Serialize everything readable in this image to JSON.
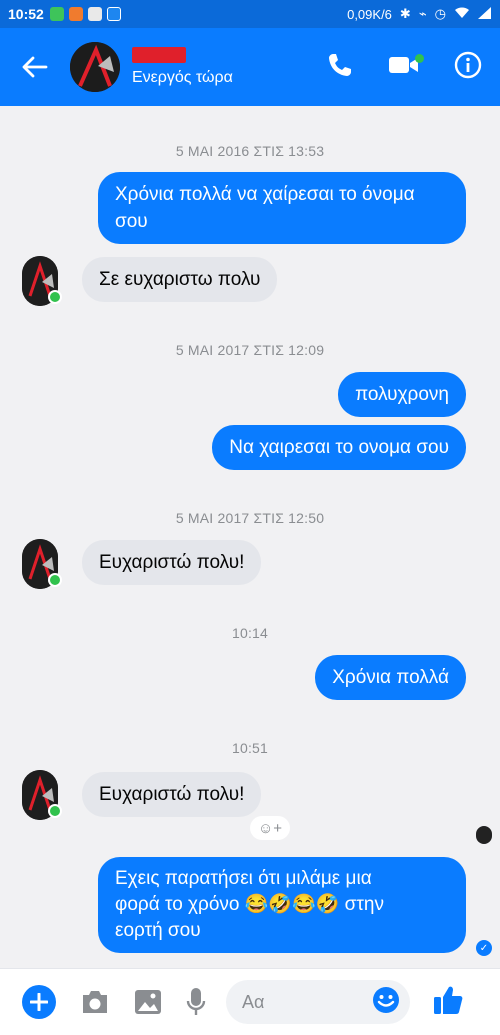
{
  "status_bar": {
    "time": "10:52",
    "speed": "0,09K/6"
  },
  "header": {
    "contact_status": "Ενεργός τώρα"
  },
  "messages": [
    {
      "type": "timestamp",
      "text": "5 ΜΑΙ 2016 ΣΤΙΣ 13:53"
    },
    {
      "type": "outgoing",
      "text": "Χρόνια πολλά να χαίρεσαι το όνομα σου"
    },
    {
      "type": "incoming",
      "text": "Σε ευχαριστω πολυ"
    },
    {
      "type": "timestamp",
      "text": "5 ΜΑΙ 2017 ΣΤΙΣ 12:09"
    },
    {
      "type": "outgoing",
      "text": "πολυχρονη"
    },
    {
      "type": "outgoing",
      "text": "Να χαιρεσαι το ονομα σου"
    },
    {
      "type": "timestamp",
      "text": "5 ΜΑΙ 2017 ΣΤΙΣ 12:50"
    },
    {
      "type": "incoming",
      "text": "Ευχαριστώ πολυ!"
    },
    {
      "type": "timestamp",
      "text": "10:14"
    },
    {
      "type": "outgoing",
      "text": "Χρόνια πολλά"
    },
    {
      "type": "timestamp",
      "text": "10:51"
    },
    {
      "type": "incoming",
      "text": "Ευχαριστώ πολυ!"
    },
    {
      "type": "outgoing",
      "text_line1": "Εχεις παρατήσει ότι μιλάμε μια",
      "text_line2": "φορά το χρόνο 😂🤣😂🤣 στην",
      "text_line3": "εορτή σου"
    }
  ],
  "composer": {
    "placeholder": "Αα"
  },
  "colors": {
    "header": "#0a7cff",
    "outgoing_bubble": "#0a7cff",
    "incoming_bubble": "#e4e6eb",
    "online": "#31c24d"
  },
  "icons": [
    "back-arrow-icon",
    "phone-icon",
    "video-camera-icon",
    "info-icon",
    "plus-icon",
    "camera-icon",
    "gallery-icon",
    "microphone-icon",
    "emoji-icon",
    "thumbs-up-icon"
  ]
}
